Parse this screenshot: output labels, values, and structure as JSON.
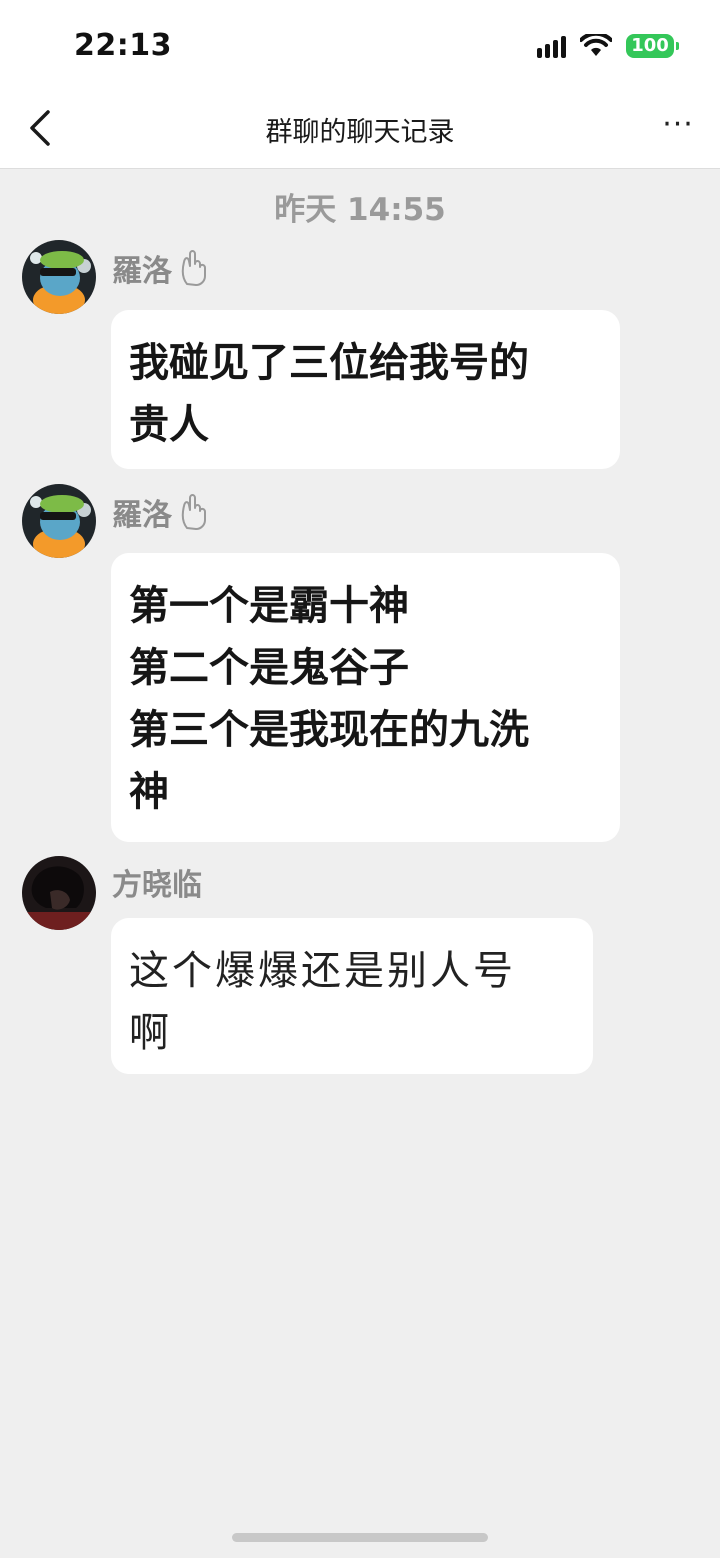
{
  "status_bar": {
    "time": "22:13",
    "battery": "100",
    "signal_icon": "cellular-signal-icon",
    "wifi_icon": "wifi-icon"
  },
  "nav": {
    "title": "群聊的聊天记录",
    "back_icon": "chevron-left-icon",
    "more_label": "···"
  },
  "timestamp": "昨天 14:55",
  "messages": [
    {
      "sender": "羅洛",
      "badge_icon": "hand-icon",
      "text": "我碰见了三位给我号的\n贵人"
    },
    {
      "sender": "羅洛",
      "badge_icon": "hand-icon",
      "text": "第一个是霸十神\n第二个是鬼谷子\n第三个是我现在的九洗\n神"
    },
    {
      "sender": "方晓临",
      "text": "这个爆爆还是别人号\n啊"
    }
  ]
}
